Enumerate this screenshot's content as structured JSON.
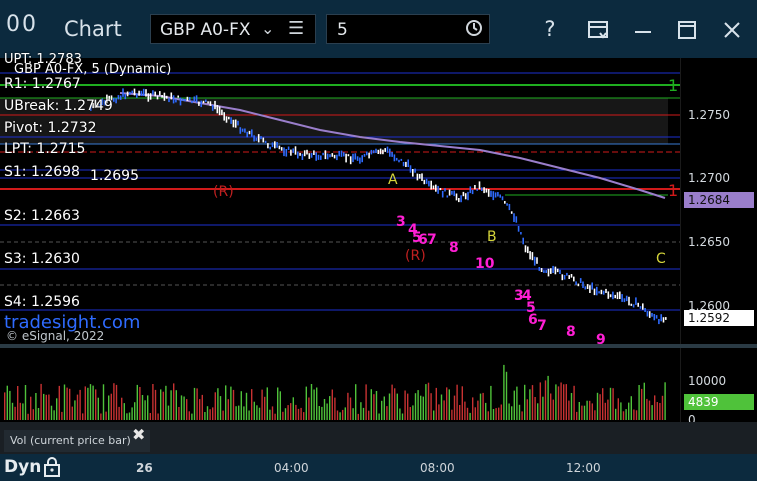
{
  "window": {
    "app_title": "Chart",
    "app_icon_glyph": "00",
    "symbol": "GBP A0-FX",
    "interval": "5",
    "icons": [
      "app-icon",
      "chevron-down-icon",
      "menu-icon",
      "clock-icon",
      "help-icon",
      "template-icon",
      "minimize-icon",
      "maximize-icon",
      "close-icon"
    ]
  },
  "chart_title": "GBP A0-FX, 5 (Dynamic)",
  "levels": [
    {
      "label": "UPT: 1.2783"
    },
    {
      "label": "R1: 1.2767"
    },
    {
      "label": "UBreak: 1.2749"
    },
    {
      "label": "Pivot: 1.2732"
    },
    {
      "label": "LPT: 1.2715"
    },
    {
      "label": "S1: 1.2698"
    },
    {
      "label": "1.2695"
    },
    {
      "label": "S2: 1.2663"
    },
    {
      "label": "S3: 1.2630"
    },
    {
      "label": "S4: 1.2596"
    }
  ],
  "price_axis": {
    "ticks": [
      "1.2750",
      "1.2700",
      "1.2650",
      "1.2600"
    ],
    "badge_ma": "1.2684",
    "badge_last": "1.2592"
  },
  "annotations": {
    "markers": [
      "A",
      "B",
      "C",
      "(R)",
      "(R)",
      "1",
      "1"
    ],
    "counts": [
      "3",
      "4",
      "5",
      "6",
      "7",
      "8",
      "10",
      "3",
      "4",
      "5",
      "6",
      "7",
      "8",
      "9"
    ]
  },
  "watermark": {
    "tradesight": "tradesight.com",
    "esignal": "© eSignal, 2022"
  },
  "volume": {
    "ticks": [
      "10000",
      "0"
    ],
    "badge": "4839",
    "study_label": "Vol (current price bar)",
    "close_glyph": "✖"
  },
  "time_axis": {
    "mode": "Dyn",
    "labels": [
      "26",
      "04:00",
      "08:00",
      "12:00"
    ]
  },
  "colors": {
    "titlebar": "#0c2a3e",
    "up_bar": "#ffffff",
    "down_bar": "#2f6bff",
    "resistance": "#d11a1a",
    "support": "#1c2fcf",
    "pivot_green": "#1fae1f",
    "ma_line": "#9a7ecb",
    "count_magenta": "#ff1fd4",
    "vol_up": "#4fc23a",
    "vol_down": "#c83232"
  }
}
